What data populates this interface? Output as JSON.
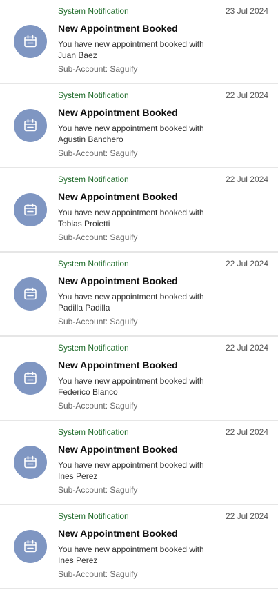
{
  "colors": {
    "avatar_bg": "#7f96c2",
    "source_text": "#1f6b2a",
    "divider": "#e6e6e6"
  },
  "notifications": [
    {
      "icon": "calendar-icon",
      "source": "System Notification",
      "date": "23 Jul 2024",
      "title": "New Appointment Booked",
      "message": "You have new appointment booked with Juan Baez",
      "subaccount": "Sub-Account: Saguify"
    },
    {
      "icon": "calendar-icon",
      "source": "System Notification",
      "date": "22 Jul 2024",
      "title": "New Appointment Booked",
      "message": "You have new appointment booked with Agustin Banchero",
      "subaccount": "Sub-Account: Saguify"
    },
    {
      "icon": "calendar-icon",
      "source": "System Notification",
      "date": "22 Jul 2024",
      "title": "New Appointment Booked",
      "message": "You have new appointment booked with Tobias Proietti",
      "subaccount": "Sub-Account: Saguify"
    },
    {
      "icon": "calendar-icon",
      "source": "System Notification",
      "date": "22 Jul 2024",
      "title": "New Appointment Booked",
      "message": "You have new appointment booked with Padilla Padilla",
      "subaccount": "Sub-Account: Saguify"
    },
    {
      "icon": "calendar-icon",
      "source": "System Notification",
      "date": "22 Jul 2024",
      "title": "New Appointment Booked",
      "message": "You have new appointment booked with Federico Blanco",
      "subaccount": "Sub-Account: Saguify"
    },
    {
      "icon": "calendar-icon",
      "source": "System Notification",
      "date": "22 Jul 2024",
      "title": "New Appointment Booked",
      "message": "You have new appointment booked with Ines Perez",
      "subaccount": "Sub-Account: Saguify"
    },
    {
      "icon": "calendar-icon",
      "source": "System Notification",
      "date": "22 Jul 2024",
      "title": "New Appointment Booked",
      "message": "You have new appointment booked with Ines Perez",
      "subaccount": "Sub-Account: Saguify"
    }
  ]
}
